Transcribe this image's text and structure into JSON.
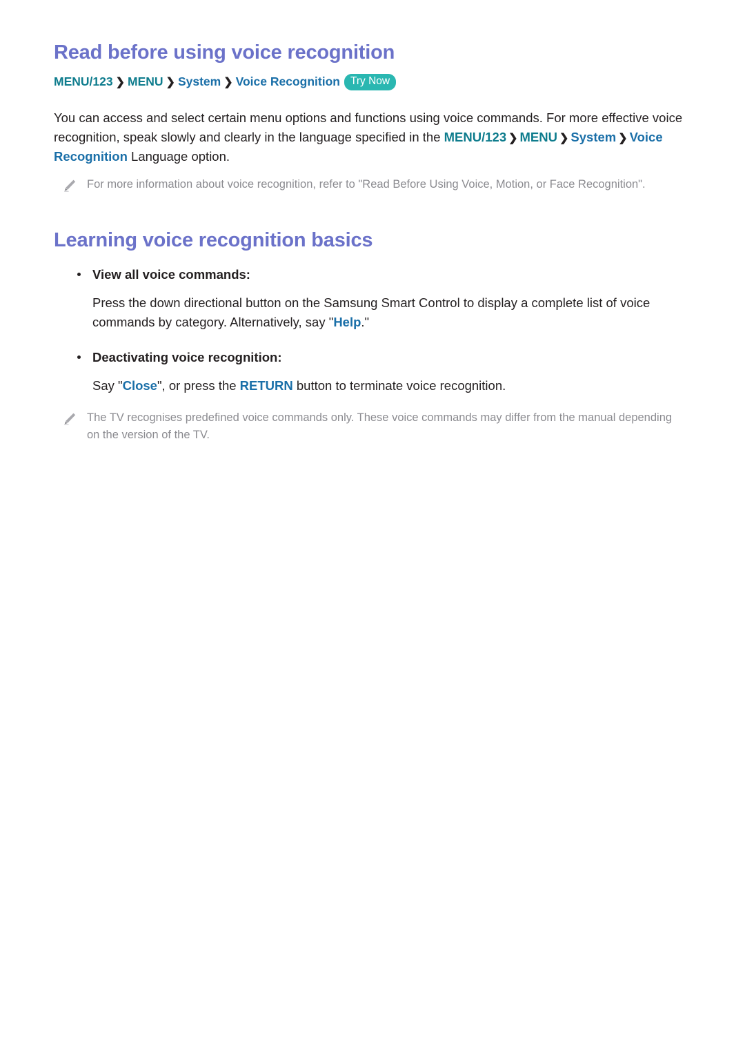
{
  "colors": {
    "heading_purple": "#6b72c9",
    "crumb_teal": "#0e7c8d",
    "crumb_blue": "#1a6fa8",
    "badge_teal": "#2ab7b1",
    "body_black": "#231f20",
    "note_gray": "#8b8b90"
  },
  "section1": {
    "title": "Read before using voice recognition",
    "breadcrumb": {
      "item1": "MENU/123",
      "sep1": "❯",
      "item2": "MENU",
      "sep2": "❯",
      "item3": "System",
      "sep3": "❯",
      "item4": "Voice Recognition",
      "badge": "Try Now"
    },
    "paragraph": {
      "part1": "You can access and select certain menu options and functions using voice commands. For more effective voice recognition, speak slowly and clearly in the language specified in the ",
      "link1": "MENU/123",
      "sep1": "❯",
      "link2": "MENU",
      "sep2": "❯",
      "link3": "System",
      "sep3": "❯",
      "link4": "Voice Recognition",
      "part2": " Language option."
    },
    "note": {
      "icon": "pencil-icon",
      "text": "For more information about voice recognition, refer to \"Read Before Using Voice, Motion, or Face Recognition\"."
    }
  },
  "section2": {
    "title": "Learning voice recognition basics",
    "bullets": [
      {
        "label": "View all voice commands:",
        "body_part1": "Press the down directional button on the Samsung Smart Control to display a complete list of voice commands by category. Alternatively, say \"",
        "body_link": "Help",
        "body_part2": ".\""
      },
      {
        "label": "Deactivating voice recognition:",
        "body_part1": "Say \"",
        "body_link": "Close",
        "body_part2": "\", or press the ",
        "body_link2": "RETURN",
        "body_part3": " button to terminate voice recognition."
      }
    ],
    "note": {
      "icon": "pencil-icon",
      "text": "The TV recognises predefined voice commands only. These voice commands may differ from the manual depending on the version of the TV."
    }
  }
}
